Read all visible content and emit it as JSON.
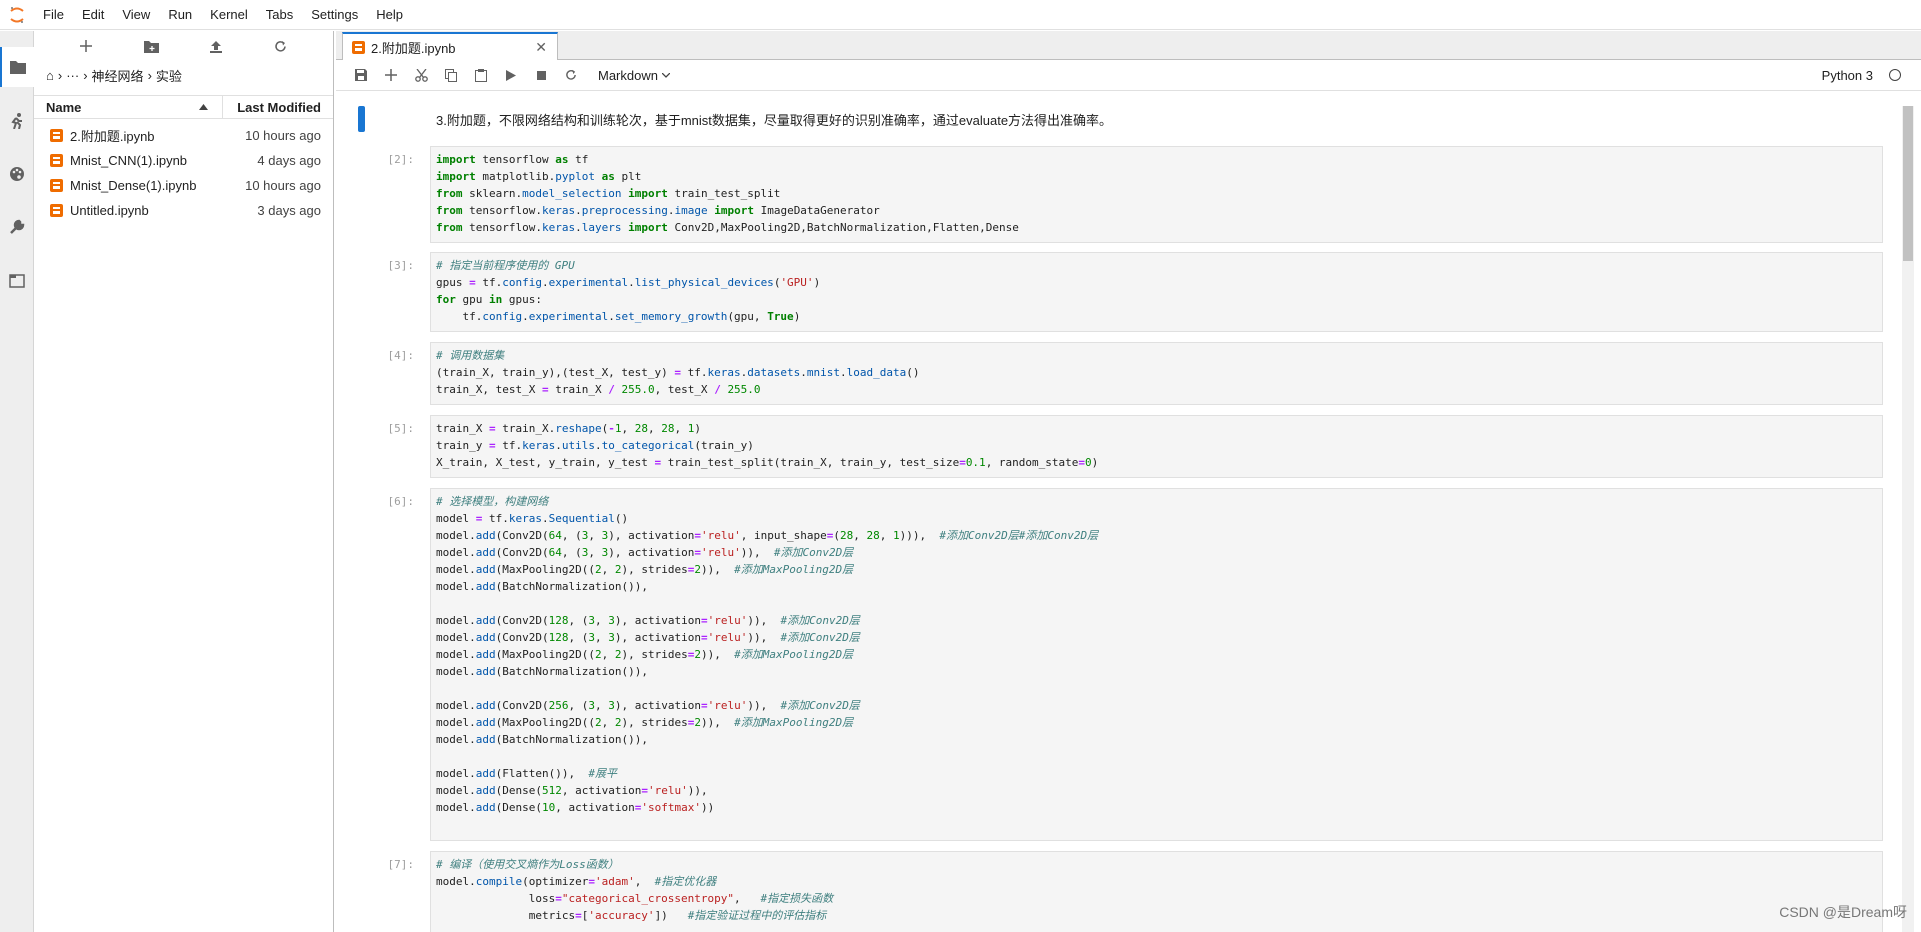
{
  "menu": [
    "File",
    "Edit",
    "View",
    "Run",
    "Kernel",
    "Tabs",
    "Settings",
    "Help"
  ],
  "filebrowser": {
    "breadcrumb": [
      "⌂",
      "›",
      "···",
      "›",
      "神经网络",
      "›",
      "实验"
    ],
    "header_name": "Name",
    "header_modified": "Last Modified",
    "files": [
      {
        "name": "2.附加题.ipynb",
        "modified": "10 hours ago"
      },
      {
        "name": "Mnist_CNN(1).ipynb",
        "modified": "4 days ago"
      },
      {
        "name": "Mnist_Dense(1).ipynb",
        "modified": "10 hours ago"
      },
      {
        "name": "Untitled.ipynb",
        "modified": "3 days ago"
      }
    ]
  },
  "tab": {
    "title": "2.附加题.ipynb",
    "close": "✕"
  },
  "toolbar": {
    "cell_type": "Markdown",
    "kernel_name": "Python 3"
  },
  "markdown_text": "3.附加题，不限网络结构和训练轮次，基于mnist数据集，尽量取得更好的识别准确率，通过evaluate方法得出准确率。",
  "cells": [
    {
      "prompt": "[2]:",
      "lines": [
        "import tensorflow as tf",
        "import matplotlib.pyplot as plt",
        "from sklearn.model_selection import train_test_split",
        "from tensorflow.keras.preprocessing.image import ImageDataGenerator",
        "from tensorflow.keras.layers import Conv2D,MaxPooling2D,BatchNormalization,Flatten,Dense"
      ]
    },
    {
      "prompt": "[3]:",
      "lines": [
        "# 指定当前程序使用的 GPU",
        "gpus = tf.config.experimental.list_physical_devices('GPU')",
        "for gpu in gpus:",
        "    tf.config.experimental.set_memory_growth(gpu, True)"
      ]
    },
    {
      "prompt": "[4]:",
      "lines": [
        "# 调用数据集",
        "(train_X, train_y),(test_X, test_y) = tf.keras.datasets.mnist.load_data()",
        "train_X, test_X = train_X / 255.0, test_X / 255.0"
      ]
    },
    {
      "prompt": "[5]:",
      "lines": [
        "train_X = train_X.reshape(-1, 28, 28, 1)",
        "train_y = tf.keras.utils.to_categorical(train_y)",
        "X_train, X_test, y_train, y_test = train_test_split(train_X, train_y, test_size=0.1, random_state=0)"
      ]
    },
    {
      "prompt": "[6]:",
      "lines": [
        "# 选择模型，构建网络",
        "model = tf.keras.Sequential()",
        "model.add(Conv2D(64, (3, 3), activation='relu', input_shape=(28, 28, 1))),  #添加Conv2D层#添加Conv2D层",
        "model.add(Conv2D(64, (3, 3), activation='relu')),  #添加Conv2D层",
        "model.add(MaxPooling2D((2, 2), strides=2)),  #添加MaxPooling2D层",
        "model.add(BatchNormalization()),",
        "",
        "model.add(Conv2D(128, (3, 3), activation='relu')),  #添加Conv2D层",
        "model.add(Conv2D(128, (3, 3), activation='relu')),  #添加Conv2D层",
        "model.add(MaxPooling2D((2, 2), strides=2)),  #添加MaxPooling2D层",
        "model.add(BatchNormalization()),",
        "",
        "model.add(Conv2D(256, (3, 3), activation='relu')),  #添加Conv2D层",
        "model.add(MaxPooling2D((2, 2), strides=2)),  #添加MaxPooling2D层",
        "model.add(BatchNormalization()),",
        "",
        "model.add(Flatten()),  #展平",
        "model.add(Dense(512, activation='relu')),",
        "model.add(Dense(10, activation='softmax'))",
        ""
      ]
    },
    {
      "prompt": "[7]:",
      "lines": [
        "# 编译（使用交叉熵作为Loss函数）",
        "model.compile(optimizer='adam',  #指定优化器",
        "              loss=\"categorical_crossentropy\",   #指定损失函数",
        "              metrics=['accuracy'])   #指定验证过程中的评估指标"
      ]
    }
  ],
  "watermark": "CSDN @是Dream呀",
  "colors": {
    "accent": "#1976d2",
    "notebook_icon": "#ef6c00"
  }
}
